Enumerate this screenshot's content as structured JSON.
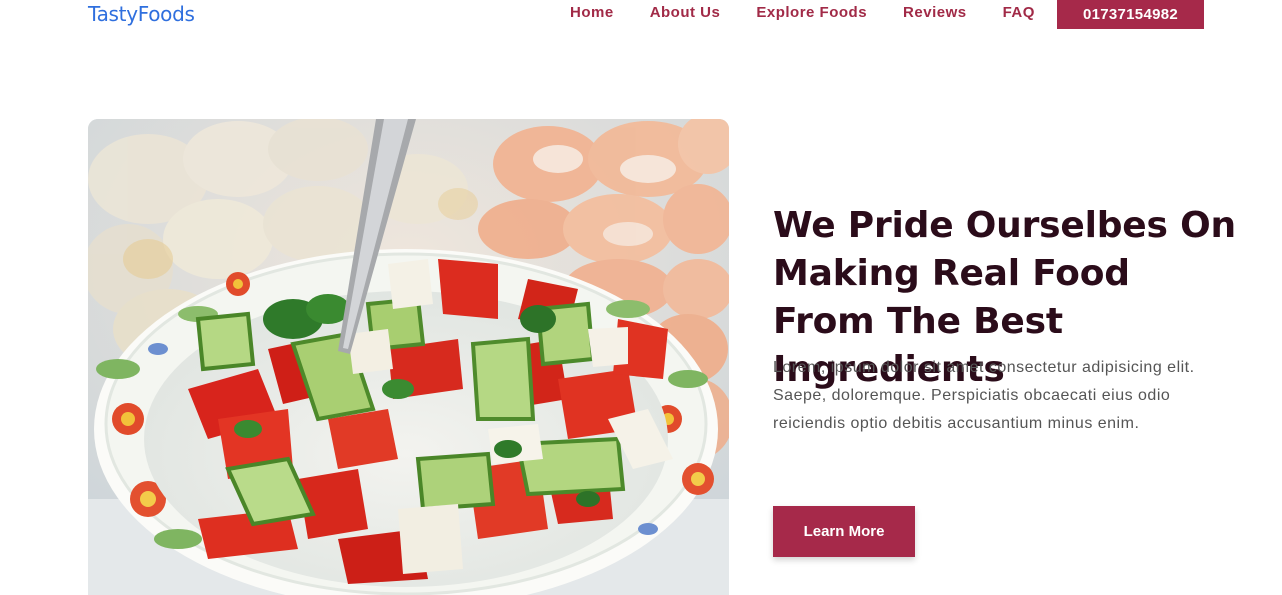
{
  "brand": {
    "name": "TastyFoods"
  },
  "nav": {
    "links": [
      "Home",
      "About Us",
      "Explore Foods",
      "Reviews",
      "FAQ"
    ],
    "phone": "01737154982"
  },
  "hero": {
    "image_icon": "salad-bowl-photo",
    "heading": "We Pride Ourselbes On Making Real Food From The Best Ingredients",
    "paragraph": "Lorem, ipsum dolor sit amet consectetur adipisicing elit. Saepe, doloremque. Perspiciatis obcaecati eius odio reiciendis optio debitis accusantium minus enim.",
    "button_label": "Learn More"
  },
  "colors": {
    "brand_blue": "#2f6fde",
    "accent": "#a6294a",
    "heading": "#2b0c1a",
    "body_text": "#555555"
  }
}
